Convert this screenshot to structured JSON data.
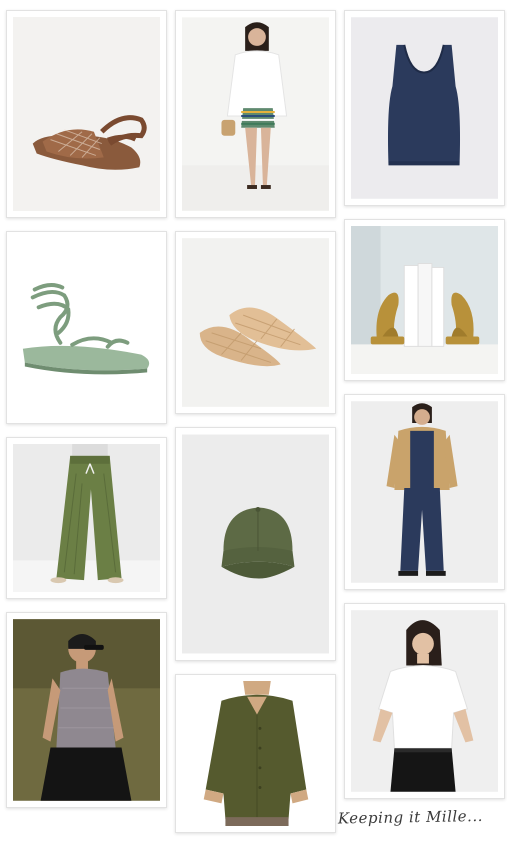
{
  "board": {
    "signature": "Keeping it Mille..."
  },
  "items": [
    {
      "id": "woven-brown-sandal"
    },
    {
      "id": "white-shirt-striped-shorts-outfit"
    },
    {
      "id": "navy-tank-top"
    },
    {
      "id": "green-lace-up-sandal"
    },
    {
      "id": "woven-mesh-flats"
    },
    {
      "id": "gold-bookends"
    },
    {
      "id": "green-wide-leg-pants"
    },
    {
      "id": "olive-baseball-cap"
    },
    {
      "id": "navy-sweatsuit-tan-jacket"
    },
    {
      "id": "grey-knit-tank-outfit"
    },
    {
      "id": "olive-button-shirt"
    },
    {
      "id": "white-tee-black-trousers"
    }
  ],
  "colors": {
    "background": "#ffffff",
    "card_border": "#e2e2e2",
    "olive": "#5d6a45",
    "navy": "#2b3a5c",
    "tan": "#c9a36b",
    "sage": "#8fae8e"
  }
}
